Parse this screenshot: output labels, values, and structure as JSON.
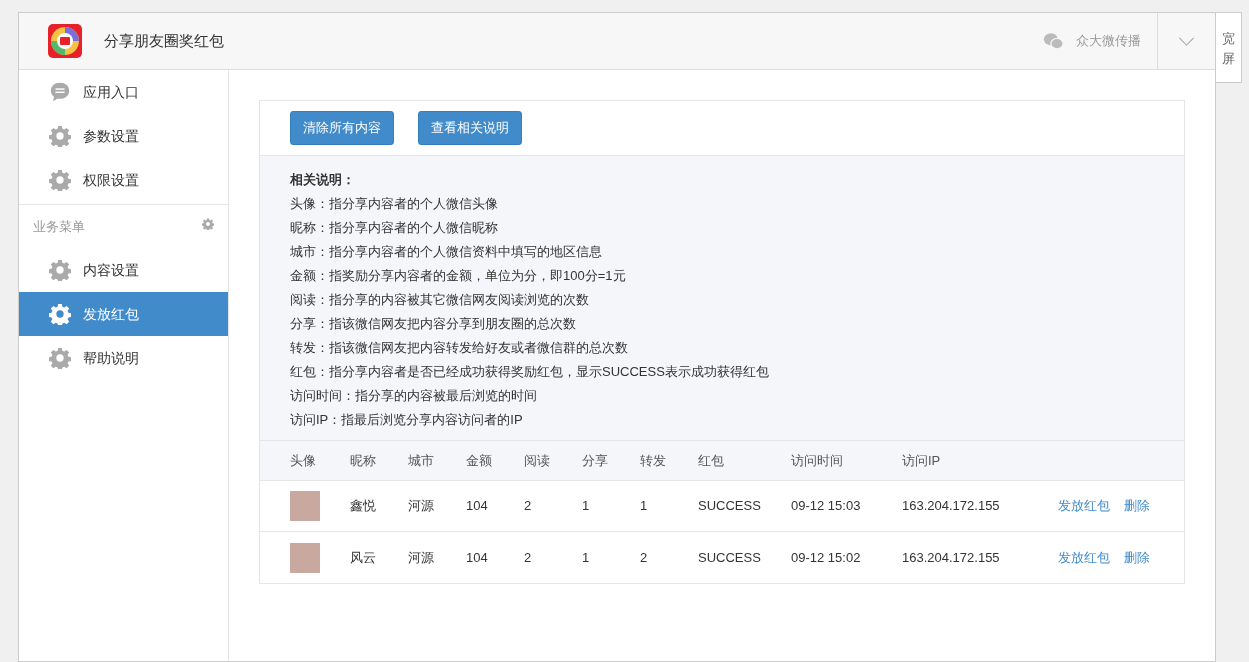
{
  "header": {
    "app_title": "分享朋友圈奖红包",
    "brand": "众大微传播",
    "wide_screen_label": "宽屏"
  },
  "sidebar": {
    "items": [
      {
        "label": "应用入口",
        "kind": "chat",
        "selected": false
      },
      {
        "label": "参数设置",
        "kind": "gear",
        "selected": false
      },
      {
        "label": "权限设置",
        "kind": "gear",
        "selected": false
      }
    ],
    "group": {
      "label": "业务菜单",
      "items": [
        {
          "label": "内容设置",
          "kind": "gear",
          "selected": false
        },
        {
          "label": "发放红包",
          "kind": "gear",
          "selected": true
        },
        {
          "label": "帮助说明",
          "kind": "gear",
          "selected": false
        }
      ]
    }
  },
  "buttons": [
    "清除所有内容",
    "查看相关说明"
  ],
  "notes": {
    "title": "相关说明：",
    "lines": [
      "头像：指分享内容者的个人微信头像",
      "昵称：指分享内容者的个人微信昵称",
      "城市：指分享内容者的个人微信资料中填写的地区信息",
      "金额：指奖励分享内容者的金额，单位为分，即100分=1元",
      "阅读：指分享的内容被其它微信网友阅读浏览的次数",
      "分享：指该微信网友把内容分享到朋友圈的总次数",
      "转发：指该微信网友把内容转发给好友或者微信群的总次数",
      "红包：指分享内容者是否已经成功获得奖励红包，显示SUCCESS表示成功获得红包",
      "访问时间：指分享的内容被最后浏览的时间",
      "访问IP：指最后浏览分享内容访问者的IP"
    ]
  },
  "table": {
    "columns": [
      "头像",
      "昵称",
      "城市",
      "金额",
      "阅读",
      "分享",
      "转发",
      "红包",
      "访问时间",
      "访问IP"
    ],
    "rows": [
      {
        "cells": [
          "",
          "鑫悦",
          "河源",
          "104",
          "2",
          "1",
          "1",
          "SUCCESS",
          "09-12 15:03",
          "163.204.172.155"
        ],
        "actions": [
          "发放红包",
          "删除"
        ]
      },
      {
        "cells": [
          "",
          "风云",
          "河源",
          "104",
          "2",
          "1",
          "2",
          "SUCCESS",
          "09-12 15:02",
          "163.204.172.155"
        ],
        "actions": [
          "发放红包",
          "删除"
        ]
      }
    ]
  }
}
